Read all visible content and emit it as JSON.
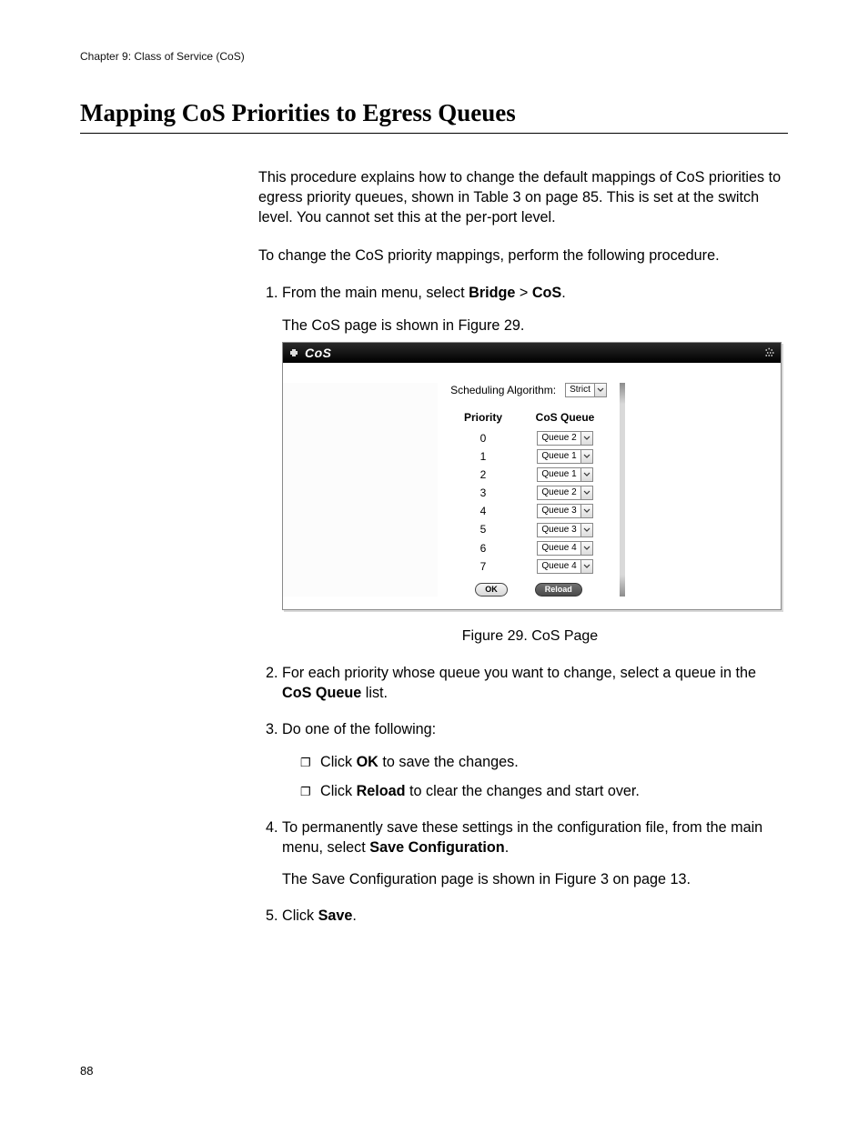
{
  "chapter_header": "Chapter 9: Class of Service (CoS)",
  "section_title": "Mapping CoS Priorities to Egress Queues",
  "intro_p1": "This procedure explains how to change the default mappings of CoS priorities to egress priority queues, shown in Table 3 on page 85. This is set at the switch level. You cannot set this at the per-port level.",
  "intro_p2": "To change the CoS priority mappings, perform the following procedure.",
  "steps": {
    "s1_a": "From the main menu, select ",
    "s1_bridge": "Bridge",
    "s1_gt": " > ",
    "s1_cos": "CoS",
    "s1_dot": ".",
    "s1_p": "The CoS page is shown in Figure 29.",
    "s2_a": "For each priority whose queue you want to change, select a queue in the ",
    "s2_b": "CoS Queue",
    "s2_c": " list.",
    "s3": "Do one of the following:",
    "s3_sub1_a": "Click ",
    "s3_sub1_b": "OK",
    "s3_sub1_c": " to save the changes.",
    "s3_sub2_a": "Click ",
    "s3_sub2_b": "Reload",
    "s3_sub2_c": " to clear the changes and start over.",
    "s4_a": "To permanently save these settings in the configuration file, from the main menu, select ",
    "s4_b": "Save Configuration",
    "s4_c": ".",
    "s4_p": "The Save Configuration page is shown in Figure 3 on page 13.",
    "s5_a": "Click ",
    "s5_b": "Save",
    "s5_c": "."
  },
  "figure_caption": "Figure 29. CoS Page",
  "page_number": "88",
  "cos": {
    "title": "CoS",
    "sched_label": "Scheduling Algorithm:",
    "sched_value": "Strict",
    "col_priority": "Priority",
    "col_queue": "CoS Queue",
    "rows": [
      {
        "p": "0",
        "q": "Queue 2"
      },
      {
        "p": "1",
        "q": "Queue 1"
      },
      {
        "p": "2",
        "q": "Queue 1"
      },
      {
        "p": "3",
        "q": "Queue 2"
      },
      {
        "p": "4",
        "q": "Queue 3"
      },
      {
        "p": "5",
        "q": "Queue 3"
      },
      {
        "p": "6",
        "q": "Queue 4"
      },
      {
        "p": "7",
        "q": "Queue 4"
      }
    ],
    "ok_label": "OK",
    "reload_label": "Reload"
  }
}
